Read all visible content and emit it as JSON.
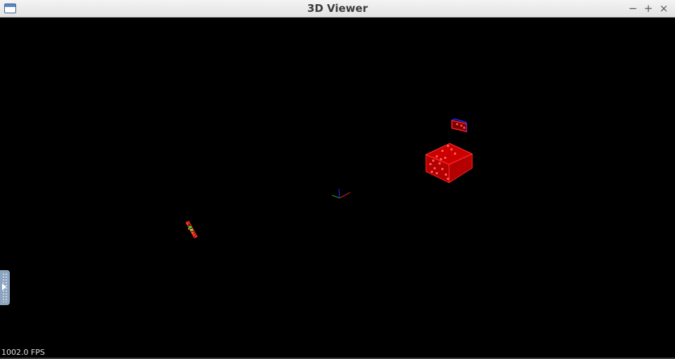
{
  "window": {
    "title": "3D Viewer",
    "buttons": {
      "minimize": "−",
      "maximize": "+",
      "close": "×"
    }
  },
  "viewport": {
    "background": "#000000",
    "fps_text": "1002.0 FPS"
  },
  "colors": {
    "accent_red": "#ff1a1a",
    "box_fill": "#cc0000",
    "blue": "#2a2aff",
    "green": "#33cc33",
    "handle": "#8da4c0"
  },
  "icons": {
    "app": "window-icon",
    "side_handle": "expand-arrow-icon"
  }
}
